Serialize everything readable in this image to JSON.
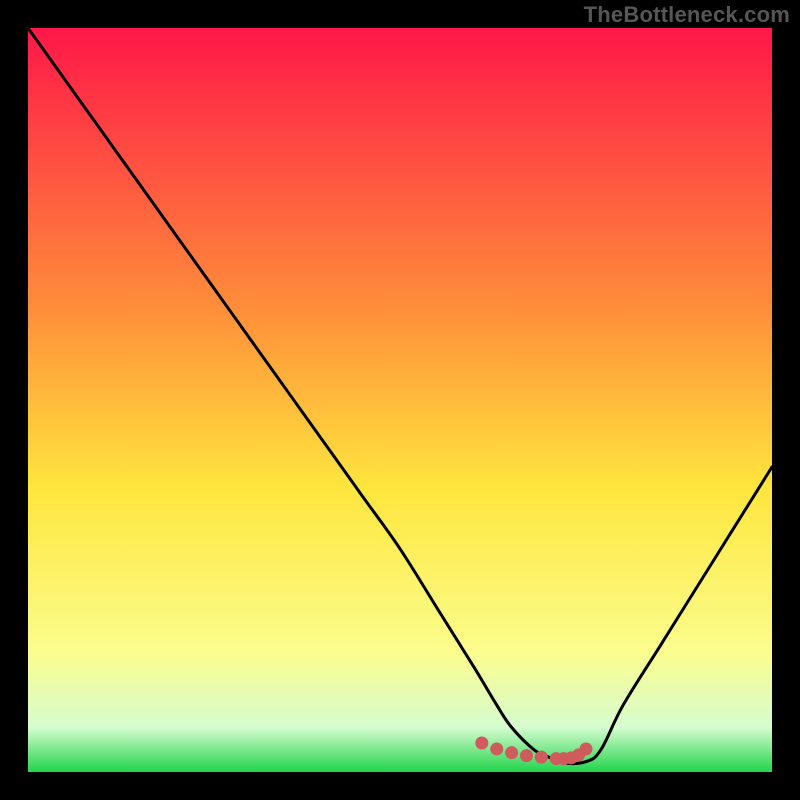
{
  "watermark": "TheBottleneck.com",
  "chart_data": {
    "type": "line",
    "title": "",
    "xlabel": "",
    "ylabel": "",
    "xlim": [
      0,
      100
    ],
    "ylim": [
      0,
      100
    ],
    "grid": false,
    "series": [
      {
        "name": "bottleneck-curve",
        "x": [
          0,
          5,
          10,
          15,
          20,
          25,
          30,
          35,
          40,
          45,
          50,
          55,
          60,
          63,
          65,
          68,
          70,
          72,
          75,
          77,
          80,
          85,
          90,
          95,
          100
        ],
        "values": [
          100,
          93,
          86,
          79,
          72,
          65,
          58,
          51,
          44,
          37,
          30,
          22,
          14,
          9,
          6,
          3,
          2,
          1.2,
          1.4,
          3,
          9,
          17,
          25,
          33,
          41
        ]
      }
    ],
    "markers": {
      "name": "optimal-range",
      "color": "#cf5b5c",
      "x": [
        61,
        63,
        65,
        67,
        69,
        71,
        72,
        73,
        74,
        75
      ],
      "values": [
        3.9,
        3.1,
        2.6,
        2.2,
        2.0,
        1.8,
        1.8,
        1.9,
        2.3,
        3.1
      ]
    },
    "background_gradient": {
      "top": "#ff1748",
      "mid1": "#ff8f3a",
      "mid2": "#ffe63e",
      "mid3": "#fbfd8e",
      "low": "#d6fccf",
      "bottom": "#21d44b"
    }
  }
}
